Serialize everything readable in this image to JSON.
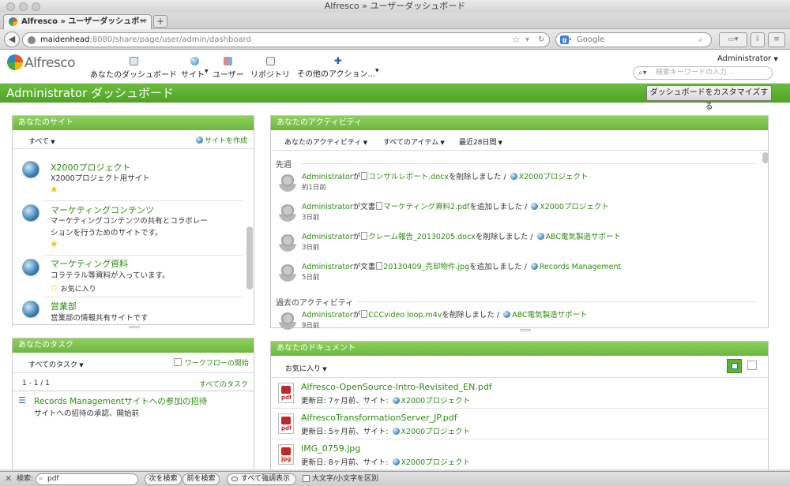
{
  "window": {
    "title": "Alfresco » ユーザーダッシュボード"
  },
  "tab": {
    "label": "Alfresco » ユーザーダッシュボード",
    "plus": "+"
  },
  "nav": {
    "url_host": "maidenhead",
    "url_rest": ":8080/share/page/user/admin/dashboard",
    "search_engine": "Google"
  },
  "app": {
    "logo": "Alfresco",
    "menu": [
      {
        "label": "あなたのダッシュボード",
        "icon": "dashboard-icon"
      },
      {
        "label": "サイト",
        "icon": "globe-icon"
      },
      {
        "label": "ユーザー",
        "icon": "people-icon"
      },
      {
        "label": "リポジトリ",
        "icon": "repository-icon"
      },
      {
        "label": "その他のアクション...",
        "icon": "plus-icon"
      }
    ],
    "user": "Administrator",
    "search_placeholder": "検索キーワードの入力..."
  },
  "page": {
    "title": "Administrator ダッシュボード",
    "customize": "ダッシュボードをカスタマイズする"
  },
  "sites": {
    "header": "あなたのサイト",
    "filter": "すべて",
    "create": "サイトを作成",
    "items": [
      {
        "name": "X2000プロジェクト",
        "desc1": "X2000プロジェクト用サイト",
        "desc2": "",
        "fav": ""
      },
      {
        "name": "マーケティングコンテンツ",
        "desc1": "マーケティングコンテンツの共有とコラボレー",
        "desc2": "ションを行うためのサイトです。",
        "fav": ""
      },
      {
        "name": "マーケティング資料",
        "desc1": "コラテラル等資料が入っています。",
        "desc2": "",
        "fav": "お気に入り"
      },
      {
        "name": "営業部",
        "desc1": "営業部の情報共有サイトです",
        "desc2": "",
        "fav": ""
      }
    ]
  },
  "tasks": {
    "header": "あなたのタスク",
    "filter": "すべてのタスク",
    "workflow": "ワークフローの開始",
    "count": "1 - 1 / 1",
    "all": "すべてのタスク",
    "items": [
      {
        "title": "Records Managementサイトへの参加の招待",
        "desc": "サイトへの招待の承認、開始前"
      }
    ]
  },
  "activities": {
    "header": "あなたのアクティビティ",
    "filter1": "あなたのアクティビティ",
    "filter2": "すべてのアイテム",
    "filter3": "最近28日間",
    "section1": "先週",
    "section2": "過去のアクティビティ",
    "items": [
      {
        "user": "Administrator",
        "mid": "が",
        "file": "コンサルレポート.docx",
        "action": "を削除しました / ",
        "site": "X2000プロジェクト",
        "ago": "約1日前"
      },
      {
        "user": "Administrator",
        "mid": "が文書",
        "file": "マーケティング資料2.pdf",
        "action": "を追加しました / ",
        "site": "X2000プロジェクト",
        "ago": "3日前"
      },
      {
        "user": "Administrator",
        "mid": "が",
        "file": "クレーム報告_20130205.docx",
        "action": "を削除しました / ",
        "site": "ABC電気製造サポート",
        "ago": "3日前"
      },
      {
        "user": "Administrator",
        "mid": "が文書",
        "file": "20130409_売却物件.jpg",
        "action": "を追加しました / ",
        "site": "Records Management",
        "ago": "5日前"
      },
      {
        "user": "Administrator",
        "mid": "が",
        "file": "CCCvideo loop.m4v",
        "action": "を削除しました / ",
        "site": "ABC電気製造サポート",
        "ago": "9日前"
      }
    ]
  },
  "documents": {
    "header": "あなたのドキュメント",
    "filter": "お気に入り",
    "items": [
      {
        "name": "Alfresco-OpenSource-Intro-Revisited_EN.pdf",
        "meta": "更新日: 7ヶ月前、サイト: ",
        "site": "X2000プロジェクト",
        "type": "pdf"
      },
      {
        "name": "AlfrescoTransformationServer_JP.pdf",
        "meta": "更新日: 5ヶ月前、サイト: ",
        "site": "X2000プロジェクト",
        "type": "pdf"
      },
      {
        "name": "IMG_0759.jpg",
        "meta": "更新日: 8ヶ月前、サイト: ",
        "site": "X2000プロジェクト",
        "type": "jpg"
      }
    ]
  },
  "findbar": {
    "label": "検索:",
    "value": "pdf",
    "next": "次を検索",
    "prev": "前を検索",
    "highlight": "すべて強調表示",
    "case": "大文字/小文字を区別"
  }
}
